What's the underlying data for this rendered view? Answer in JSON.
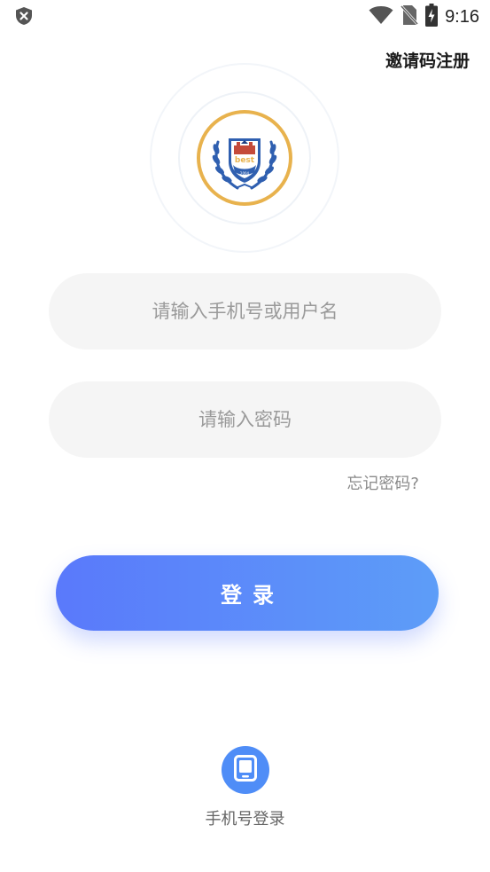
{
  "status_bar": {
    "time": "9:16",
    "left_icon": "shield-x-icon",
    "icons": [
      "wifi-icon",
      "no-sim-icon",
      "battery-charging-icon"
    ]
  },
  "header": {
    "invite_register_label": "邀请码注册"
  },
  "logo": {
    "icon": "school-emblem-icon",
    "emblem_text": "best",
    "emblem_year": "2004"
  },
  "form": {
    "username_placeholder": "请输入手机号或用户名",
    "username_value": "",
    "password_placeholder": "请输入密码",
    "password_value": "",
    "forgot_label": "忘记密码?",
    "login_label": "登录"
  },
  "alt_login": {
    "phone_login_label": "手机号登录",
    "icon": "phone-icon"
  },
  "colors": {
    "accent_start": "#5a79fb",
    "accent_end": "#5d9df8",
    "phone_button": "#4f8df7",
    "input_bg": "#f5f5f5",
    "emblem_ring": "#e8b24d",
    "emblem_blue": "#2f5fb0"
  }
}
